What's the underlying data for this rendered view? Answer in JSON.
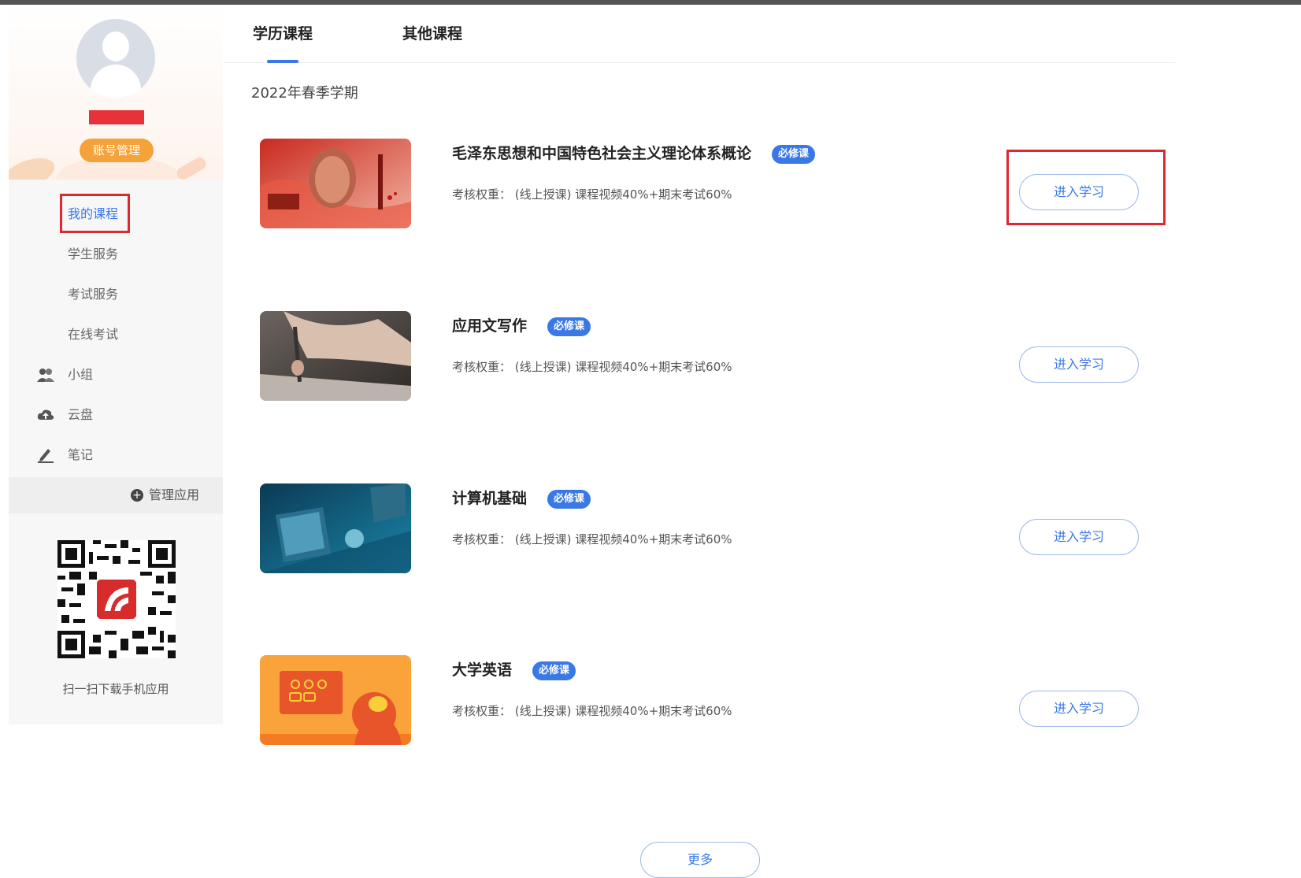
{
  "sidebar": {
    "account_button": "账号管理",
    "menu": [
      {
        "label": "我的课程",
        "icon": ""
      },
      {
        "label": "学生服务",
        "icon": ""
      },
      {
        "label": "考试服务",
        "icon": ""
      },
      {
        "label": "在线考试",
        "icon": ""
      },
      {
        "label": "小组",
        "icon": "group-icon"
      },
      {
        "label": "云盘",
        "icon": "cloud-upload-icon"
      },
      {
        "label": "笔记",
        "icon": "pen-note-icon"
      }
    ],
    "manage_apps": "管理应用",
    "qr_caption": "扫一扫下载手机应用"
  },
  "tabs": [
    {
      "label": "学历课程",
      "active": true
    },
    {
      "label": "其他课程",
      "active": false
    }
  ],
  "term": "2022年春季学期",
  "courses": [
    {
      "title": "毛泽东思想和中国特色社会主义理论体系概论",
      "badge": "必修课",
      "weight": "考核权重： (线上授课) 课程视频40%+期末考试60%",
      "button": "进入学习"
    },
    {
      "title": "应用文写作",
      "badge": "必修课",
      "weight": "考核权重： (线上授课) 课程视频40%+期末考试60%",
      "button": "进入学习"
    },
    {
      "title": "计算机基础",
      "badge": "必修课",
      "weight": "考核权重： (线上授课) 课程视频40%+期末考试60%",
      "button": "进入学习"
    },
    {
      "title": "大学英语",
      "badge": "必修课",
      "weight": "考核权重： (线上授课) 课程视频40%+期末考试60%",
      "button": "进入学习"
    }
  ],
  "more_button": "更多",
  "colors": {
    "accent": "#3a78e6",
    "highlight": "#e0262e",
    "account": "#f6a23a"
  }
}
